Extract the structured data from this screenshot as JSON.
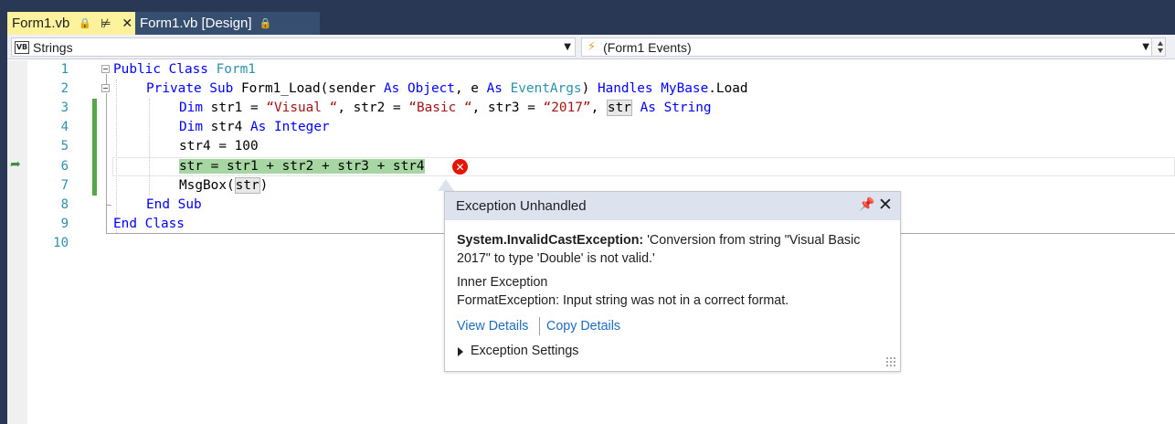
{
  "tabs": [
    {
      "label": "Form1.vb",
      "pin_icon": "pin-icon",
      "close_icon": "close-icon",
      "lock_icon": "lock-icon",
      "active": true
    },
    {
      "label": "Form1.vb [Design]",
      "lock_icon": "lock-icon",
      "active": false
    }
  ],
  "navbar": {
    "class_combo": {
      "icon": "VB",
      "value": "Strings"
    },
    "member_combo": {
      "icon": "lightning-icon",
      "value": "(Form1 Events)"
    }
  },
  "line_numbers": [
    "1",
    "2",
    "3",
    "4",
    "5",
    "6",
    "7",
    "8",
    "9",
    "10"
  ],
  "code": {
    "l1": {
      "kw": "Public Class",
      "name": "Form1"
    },
    "l2": {
      "kw1": "Private Sub",
      "name": "Form1_Load(sender",
      "kw2": "As",
      "type1": "Object",
      "sep": ", e",
      "kw3": "As",
      "type2": "EventArgs",
      "close": ")",
      "kw4": "Handles",
      "type3": "MyBase",
      "rest": ".Load"
    },
    "l3": {
      "kw": "Dim",
      "a": "str1 =",
      "s1": "“Visual “",
      "b": ", str2 =",
      "s2": "“Basic “",
      "c": ", str3 =",
      "s3": "“2017”",
      "d": ",",
      "hl": "str",
      "kw2": "As",
      "type": "String"
    },
    "l4": {
      "kw": "Dim",
      "a": "str4",
      "kw2": "As",
      "type": "Integer"
    },
    "l5": {
      "text": "str4 = 100"
    },
    "l6": {
      "text": "str = str1 + str2 + str3 + str4"
    },
    "l7": {
      "a": "MsgBox(",
      "hl": "str",
      "b": ")"
    },
    "l8": {
      "kw": "End Sub"
    },
    "l9": {
      "kw": "End Class"
    }
  },
  "exception_popup": {
    "title": "Exception Unhandled",
    "exception_type": "System.InvalidCastException:",
    "message": "'Conversion from string \"Visual Basic 2017\" to type 'Double' is not valid.'",
    "inner_label": "Inner Exception",
    "inner_message": "FormatException: Input string was not in a correct format.",
    "view_details": "View Details",
    "copy_details": "Copy Details",
    "settings": "Exception Settings"
  },
  "colors": {
    "frame": "#293955",
    "active_tab": "#fff29d",
    "keyword": "#0000ff",
    "type": "#2b91af",
    "string": "#a31515",
    "error_highlight": "#a6d7a3",
    "error_icon": "#e51400",
    "link": "#1e6dc0"
  }
}
